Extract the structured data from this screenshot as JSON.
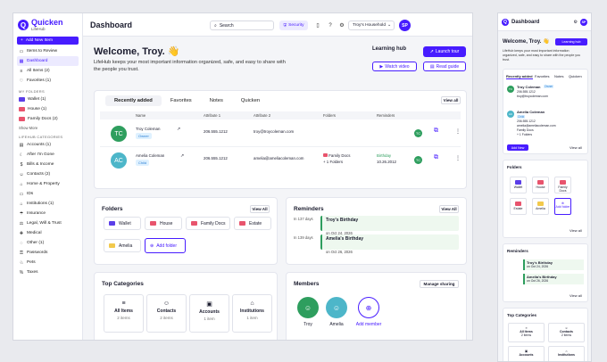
{
  "app": {
    "name": "Quicken",
    "sub": "LifeHub"
  },
  "sidebar": {
    "add_label": "Add New Item",
    "items": [
      {
        "label": "Items to Review",
        "icon": "inbox-icon"
      },
      {
        "label": "Dashboard",
        "icon": "grid-icon"
      },
      {
        "label": "All Items (2)",
        "icon": "list-icon"
      },
      {
        "label": "Favorites (1)",
        "icon": "heart-icon"
      }
    ],
    "folders_heading": "MY FOLDERS",
    "folders": [
      {
        "label": "Wallet (1)",
        "color": "#5b3ee8"
      },
      {
        "label": "House (1)",
        "color": "#e8546d"
      },
      {
        "label": "Family Docs (2)",
        "color": "#e8546d"
      }
    ],
    "show_more": "Show More",
    "categories_heading": "LIFEHUB CATEGORIES",
    "categories": [
      "Accounts (1)",
      "After I'm Gone",
      "Bills & Income",
      "Contacts (2)",
      "Home & Property",
      "IDs",
      "Institutions (1)",
      "Insurance",
      "Legal, Will & Trust",
      "Medical",
      "Other (1)",
      "Passwords",
      "Pets",
      "Taxes"
    ]
  },
  "topbar": {
    "title": "Dashboard",
    "search_placeholder": "Search",
    "security_label": "Security",
    "household": "Troy's Household",
    "avatar_initials": "SP"
  },
  "welcome": {
    "title": "Welcome, Troy. 👋",
    "subtitle": "LifeHub keeps your most important information organized, safe, and easy to share with the people you trust."
  },
  "learning": {
    "title": "Learning hub",
    "tour": "Launch tour",
    "video": "Watch video",
    "guide": "Read guide"
  },
  "recent": {
    "tabs": [
      "Recently added",
      "Favorites",
      "Notes",
      "Quicken"
    ],
    "view_all": "View all",
    "columns": [
      "Name",
      "Attribute 1",
      "Attribute 2",
      "Folders",
      "Reminders"
    ],
    "rows": [
      {
        "initials": "TC",
        "name": "Troy Coleman",
        "role": "Owner",
        "attr1": "206.555.1212",
        "attr2": "troy@troycoleman.com",
        "folders": "",
        "reminder": "",
        "reminder_date": "",
        "share": "TC",
        "color": "#2e9e5e"
      },
      {
        "initials": "AC",
        "name": "Amelia Coleman",
        "role": "Child",
        "attr1": "206.555.1212",
        "attr2": "amelia@ameliacoleman.com",
        "folders": "Family Docs",
        "folders_more": "+ 1 Folders",
        "reminder": "Birthday",
        "reminder_date": "10.26.2012",
        "share": "TC",
        "color": "#4db6c9"
      }
    ]
  },
  "folders": {
    "title": "Folders",
    "view_all": "View All",
    "items": [
      {
        "label": "Wallet",
        "color": "#5b3ee8"
      },
      {
        "label": "House",
        "color": "#e8546d"
      },
      {
        "label": "Family Docs",
        "color": "#e8546d"
      },
      {
        "label": "Estate",
        "color": "#e8546d"
      },
      {
        "label": "Amelia",
        "color": "#f2c94c"
      }
    ],
    "add": "Add folder"
  },
  "reminders": {
    "title": "Reminders",
    "view_all": "View All",
    "items": [
      {
        "days": "In 137 days",
        "title": "Troy's Birthday",
        "date": "on Oct 24, 2026"
      },
      {
        "days": "In 139 days",
        "title": "Amelia's Birthday",
        "date": "on Oct 26, 2026"
      }
    ]
  },
  "top_categories": {
    "title": "Top Categories",
    "items": [
      {
        "label": "All Items",
        "count": "2 items",
        "icon": "list-icon"
      },
      {
        "label": "Contacts",
        "count": "2 items",
        "icon": "person-icon"
      },
      {
        "label": "Accounts",
        "count": "1 item",
        "icon": "wallet-icon"
      },
      {
        "label": "Institutions",
        "count": "1 item",
        "icon": "bank-icon"
      }
    ]
  },
  "members": {
    "title": "Members",
    "manage": "Manage sharing",
    "items": [
      {
        "label": "Troy",
        "color": "#2e9e5e"
      },
      {
        "label": "Amelia",
        "color": "#4db6c9"
      }
    ],
    "add": "Add member"
  },
  "mobile": {
    "title": "Dashboard",
    "welcome": "Welcome, Troy. 👋",
    "hub": "Learning hub",
    "sub": "LifeHub keeps your most important information organized, safe, and easy to share with the people you trust.",
    "tabs": [
      "Recently added",
      "Favorites",
      "Notes",
      "Quicken"
    ],
    "troy": "Troy Coleman",
    "owner": "Owner",
    "phone": "206.555.1212",
    "troy_email": "troy@troycoleman.com",
    "amelia": "Amelia Coleman",
    "child": "Child",
    "amelia_email": "amelia@ameliacoleman.com",
    "family": "Family Docs",
    "more": "+ 1 Folders",
    "add_new": "Add New",
    "view_all": "View all",
    "folders": "Folders",
    "folder_items": [
      "Wallet",
      "House",
      "Family Docs",
      "Estate",
      "Amelia",
      "Add folder"
    ],
    "reminders": "Reminders",
    "rem1": "Troy's Birthday",
    "rem1d": "on Oct 24, 2026",
    "rem2": "Amelia's Birthday",
    "rem2d": "on Oct 26, 2026",
    "topcat": "Top Categories",
    "cats": [
      "All Items",
      "Contacts",
      "Accounts",
      "Institutions"
    ],
    "cat_counts": [
      "2 items",
      "2 items"
    ]
  }
}
